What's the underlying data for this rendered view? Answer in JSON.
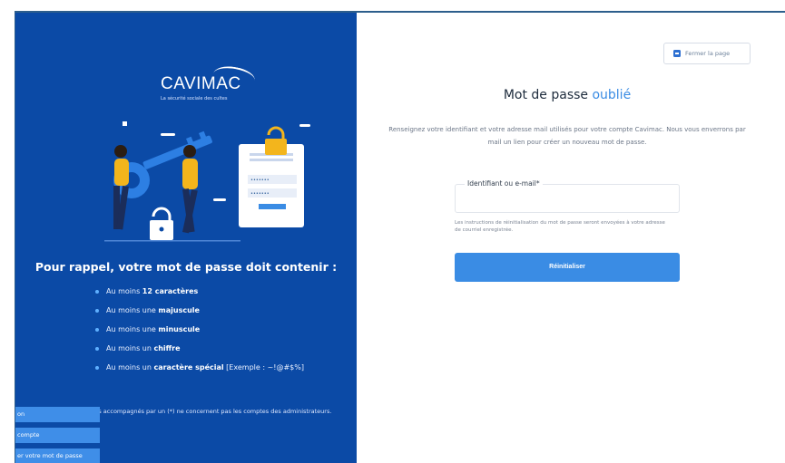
{
  "brand": {
    "name": "CAVIMAC",
    "tagline": "La sécurité sociale des cultes"
  },
  "illustration": {
    "login_field_1": "•••••••",
    "login_field_2": "•••••••"
  },
  "reminder": {
    "title": "Pour rappel, votre mot de passe doit contenir :",
    "rules": [
      {
        "prefix": "Au moins ",
        "bold": "12 caractères",
        "suffix": ""
      },
      {
        "prefix": "Au moins une ",
        "bold": "majuscule",
        "suffix": ""
      },
      {
        "prefix": "Au moins une ",
        "bold": "minuscule",
        "suffix": ""
      },
      {
        "prefix": "Au moins un ",
        "bold": "chiffre",
        "suffix": ""
      },
      {
        "prefix": "Au moins un ",
        "bold": "caractère spécial",
        "suffix": " [Exemple : ~!@#$%]"
      }
    ],
    "note": "Les éléments accompagnés par un (*) ne concernent pas les comptes des administrateurs."
  },
  "left_buttons": [
    "on",
    "compte",
    "er votre mot de passe"
  ],
  "close_button": "Fermer la page",
  "form": {
    "title_main": "Mot de passe ",
    "title_accent": "oublié",
    "description": "Renseignez votre identifiant et votre adresse mail utilisés pour votre compte Cavimac. Nous vous enverrons par mail un lien pour créer un nouveau mot de passe.",
    "field_label": "Identifiant ou e-mail*",
    "field_value": "",
    "help": "Les instructions de réinitialisation du mot de passe seront envoyées à votre adresse de courriel enregistrée.",
    "submit": "Réinitialiser"
  },
  "colors": {
    "panel": "#0b4aa6",
    "accent": "#3a8ce4",
    "illustration_yellow": "#f3b51c"
  }
}
